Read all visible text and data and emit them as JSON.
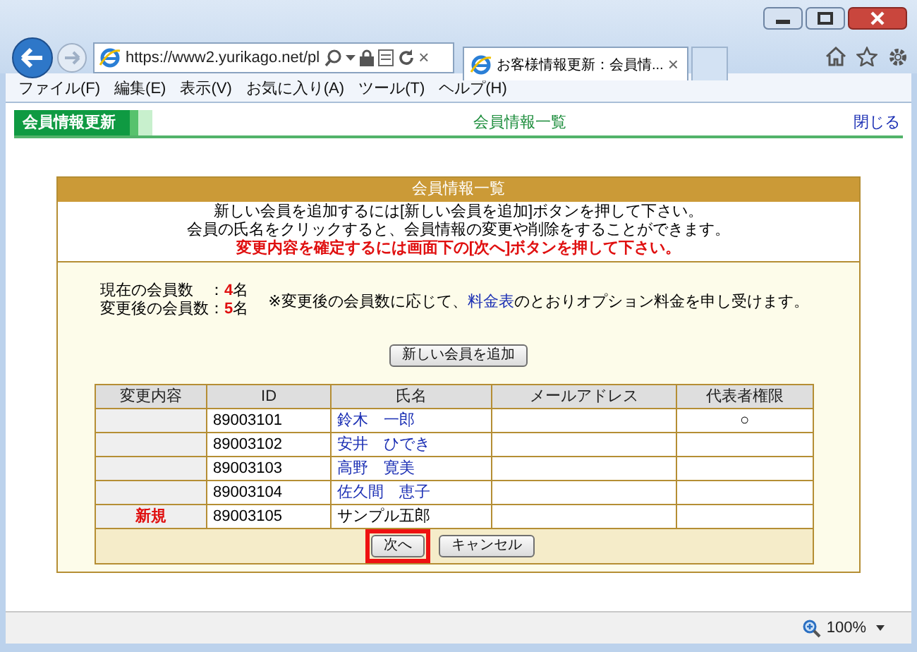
{
  "browser": {
    "url": "https://www2.yurikago.net/pl",
    "tab_title": "お客様情報更新：会員情...",
    "tab_close": "×",
    "address_close": "×",
    "menu": [
      "ファイル(F)",
      "編集(E)",
      "表示(V)",
      "お気に入り(A)",
      "ツール(T)",
      "ヘルプ(H)"
    ]
  },
  "page": {
    "app_tab": "会員情報更新",
    "title": "会員情報一覧",
    "close_link": "閉じる"
  },
  "panel": {
    "title": "会員情報一覧",
    "instructions": [
      {
        "text": "新しい会員を追加するには[新しい会員を追加]ボタンを押して下さい。",
        "kind": "normal"
      },
      {
        "text": "会員の氏名をクリックすると、会員情報の変更や削除をすることができます。",
        "kind": "normal"
      },
      {
        "text": "変更内容を確定するには画面下の[次へ]ボタンを押して下さい。",
        "kind": "warning"
      }
    ],
    "counts": [
      {
        "label": "現在の会員数",
        "separator": "：",
        "value": "4",
        "unit": "名"
      },
      {
        "label": "変更後の会員数",
        "separator": "：",
        "value": "5",
        "unit": "名"
      }
    ],
    "note": {
      "before": "※変更後の会員数に応じて、",
      "link": "料金表",
      "after": "のとおりオプション料金を申し受けます。"
    },
    "add_button": "新しい会員を追加",
    "table": {
      "columns": [
        "変更内容",
        "ID",
        "氏名",
        "メールアドレス",
        "代表者権限"
      ],
      "rows": [
        {
          "change": "",
          "id": "89003101",
          "name": "鈴木　一郎",
          "linked": true,
          "representative": "○"
        },
        {
          "change": "",
          "id": "89003102",
          "name": "安井　ひでき",
          "linked": true,
          "representative": ""
        },
        {
          "change": "",
          "id": "89003103",
          "name": "高野　寛美",
          "linked": true,
          "representative": ""
        },
        {
          "change": "",
          "id": "89003104",
          "name": "佐久間　恵子",
          "linked": true,
          "representative": ""
        },
        {
          "change": "新規",
          "id": "89003105",
          "name": "サンプル五郎",
          "linked": false,
          "representative": ""
        }
      ]
    },
    "buttons": [
      {
        "label": "次へ",
        "highlighted": true
      },
      {
        "label": "キャンセル",
        "highlighted": false
      }
    ]
  },
  "status_bar": {
    "zoom": "100%"
  }
}
